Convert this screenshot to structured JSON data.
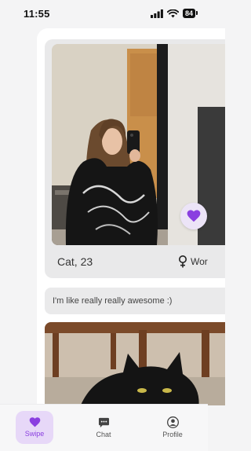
{
  "status_bar": {
    "time": "11:55",
    "battery": "84"
  },
  "profile": {
    "name_age": "Cat, 23",
    "gender": "Wor",
    "bio": "I'm like really really awesome :)"
  },
  "nav": {
    "items": [
      {
        "label": "Swipe",
        "icon": "heart-icon",
        "active": true
      },
      {
        "label": "Chat",
        "icon": "chat-bubble-icon",
        "active": false
      },
      {
        "label": "Profile",
        "icon": "person-icon",
        "active": false
      }
    ]
  },
  "colors": {
    "accent": "#8a3fe0",
    "accent_light": "#e7d8f8"
  }
}
